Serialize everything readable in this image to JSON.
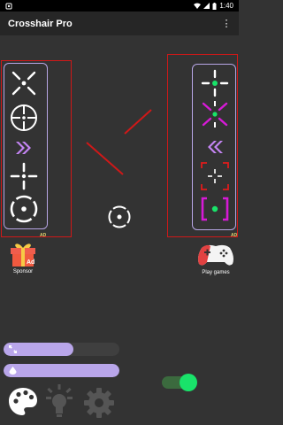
{
  "status_bar": {
    "time": "1:40"
  },
  "app_bar": {
    "title": "Crosshair Pro",
    "menu_glyph": "⋮"
  },
  "left_panel": {
    "ad_label": "AD",
    "items": [
      "x-crosshair",
      "scope-crosshair",
      "chevron-right-crosshair",
      "dot-cross-crosshair",
      "circle-crosshair"
    ]
  },
  "right_panel": {
    "ad_label": "AD",
    "items": [
      "green-dot-crosshair",
      "purple-x-crosshair",
      "chevron-left-crosshair",
      "red-corners-crosshair",
      "magenta-brackets-crosshair"
    ]
  },
  "sponsor": {
    "label": "Sponsor",
    "ad_text": "Ad"
  },
  "play_games": {
    "label": "Play games"
  },
  "sliders": [
    {
      "icon": "expand-icon",
      "level": 0.6
    },
    {
      "icon": "opacity-icon",
      "level": 1.0
    }
  ],
  "toggle": {
    "on": true
  },
  "colors": {
    "accent": "#b9a6ea",
    "highlight_red": "#d01818",
    "green": "#19e36a",
    "magenta": "#d61ad6",
    "background": "#333333"
  }
}
